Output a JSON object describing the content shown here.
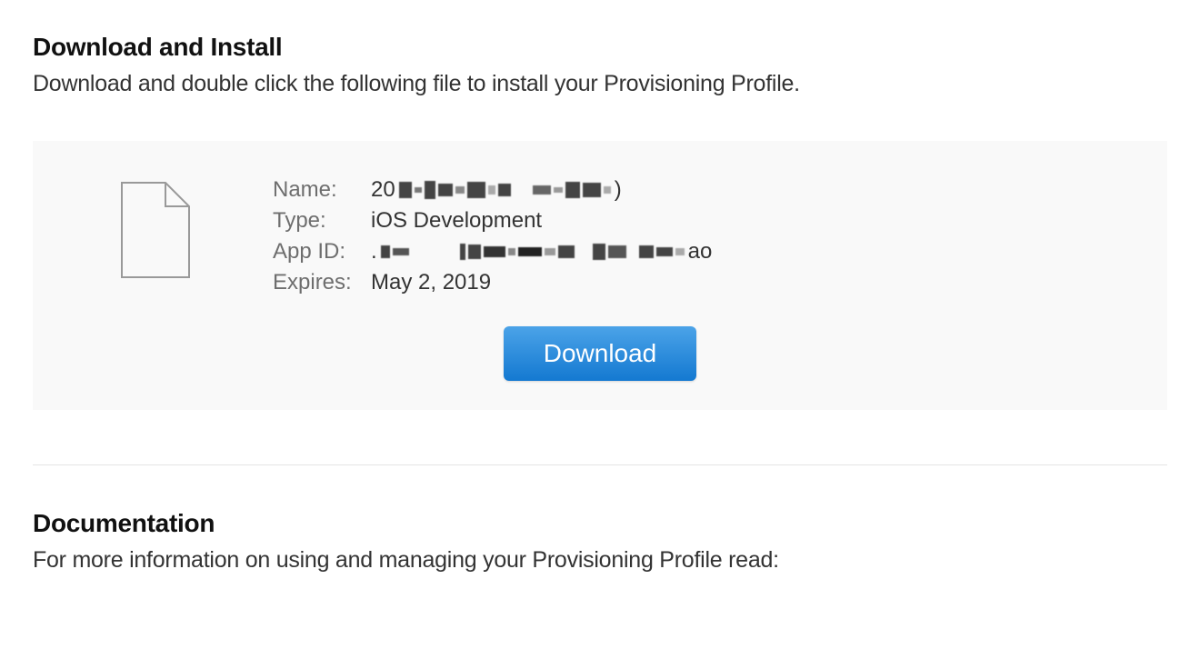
{
  "download_section": {
    "title": "Download and Install",
    "subtitle": "Download and double click the following file to install your Provisioning Profile."
  },
  "profile": {
    "labels": {
      "name": "Name:",
      "type": "Type:",
      "app_id": "App ID:",
      "expires": "Expires:"
    },
    "values": {
      "name_prefix": "20",
      "name_suffix": ")",
      "type": "iOS Development",
      "app_id_prefix": ".",
      "app_id_suffix": "ao",
      "expires": "May 2, 2019"
    },
    "button": "Download"
  },
  "documentation": {
    "title": "Documentation",
    "subtitle": "For more information on using and managing your Provisioning Profile read:"
  }
}
